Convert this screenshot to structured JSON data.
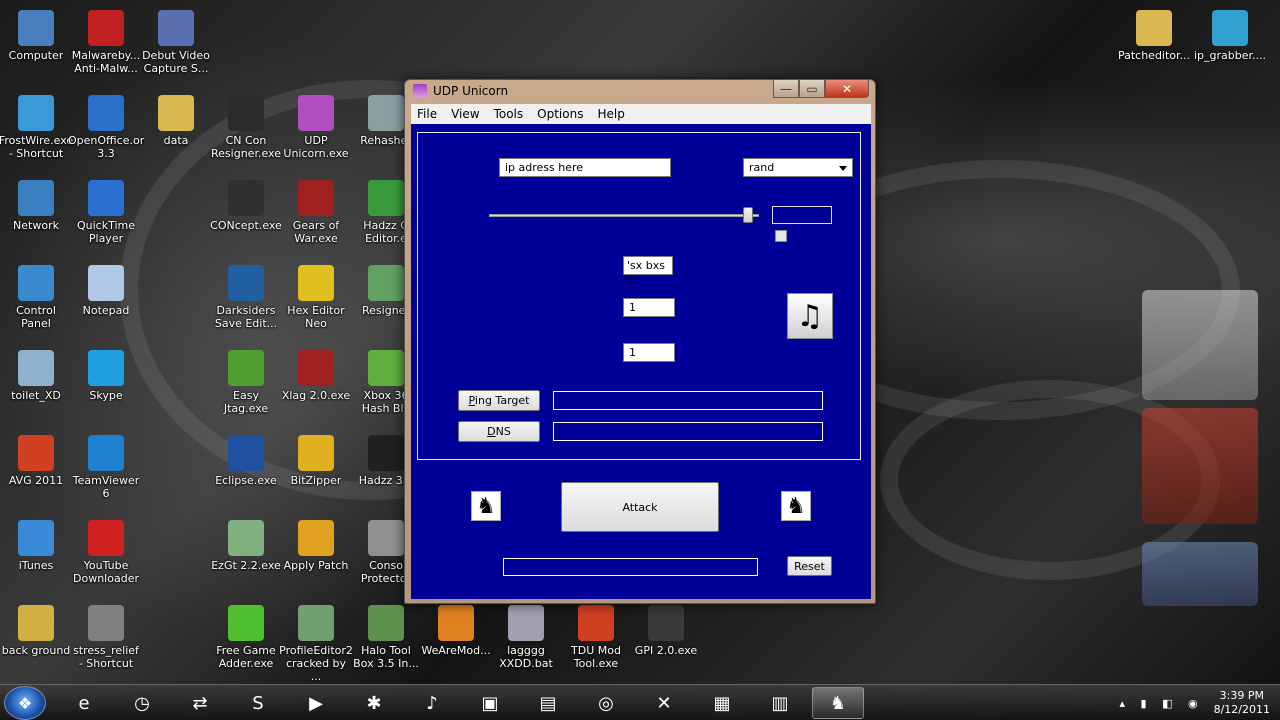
{
  "desktop_icons": [
    {
      "label": "Computer",
      "icon": "computer-icon",
      "color": "#4a7fbf"
    },
    {
      "label": "Malwareby... Anti-Malw...",
      "icon": "malwarebytes-icon",
      "color": "#c02020"
    },
    {
      "label": "Debut Video Capture S...",
      "icon": "floppy-icon",
      "color": "#5a6fb0"
    },
    {
      "label": "FrostWire.exe - Shortcut",
      "icon": "frostwire-icon",
      "color": "#3a9ad8"
    },
    {
      "label": "OpenOffice.org 3.3",
      "icon": "openoffice-icon",
      "color": "#2a70c8"
    },
    {
      "label": "data",
      "icon": "folder-icon",
      "color": "#d9b850"
    },
    {
      "label": "CN Con Resigner.exe",
      "icon": "cn-con-icon",
      "color": "#2a2a2a"
    },
    {
      "label": "UDP Unicorn.exe",
      "icon": "unicorn-icon",
      "color": "#b050c0"
    },
    {
      "label": "Rehasher",
      "icon": "rehasher-icon",
      "color": "#8aa0a0"
    },
    {
      "label": "Network",
      "icon": "network-icon",
      "color": "#3a7fbf"
    },
    {
      "label": "QuickTime Player",
      "icon": "quicktime-icon",
      "color": "#2a70d0"
    },
    {
      "label": "CONcept.exe",
      "icon": "concept-icon",
      "color": "#303030"
    },
    {
      "label": "Gears of War.exe",
      "icon": "gears-icon",
      "color": "#a02020"
    },
    {
      "label": "Hadzz G Editor.e",
      "icon": "hadzz-icon",
      "color": "#3a9a3a"
    },
    {
      "label": "Control Panel",
      "icon": "control-panel-icon",
      "color": "#3a8ad0"
    },
    {
      "label": "Notepad",
      "icon": "notepad-icon",
      "color": "#b0c8e8"
    },
    {
      "label": "Darksiders Save Edit...",
      "icon": "darksiders-icon",
      "color": "#2060a0"
    },
    {
      "label": "Hex Editor Neo",
      "icon": "hex-editor-icon",
      "color": "#e0c020"
    },
    {
      "label": "Resigner",
      "icon": "resigner-icon",
      "color": "#60a060"
    },
    {
      "label": "toilet_XD",
      "icon": "recycle-bin-icon",
      "color": "#90b0d0"
    },
    {
      "label": "Skype",
      "icon": "skype-icon",
      "color": "#20a0e0"
    },
    {
      "label": "Easy Jtag.exe",
      "icon": "xbox-icon",
      "color": "#50a030"
    },
    {
      "label": "Xlag 2.0.exe",
      "icon": "xlag-icon",
      "color": "#a02020"
    },
    {
      "label": "Xbox 36 Hash Blo",
      "icon": "xbox-hash-icon",
      "color": "#60b040"
    },
    {
      "label": "AVG 2011",
      "icon": "windows-logo-icon",
      "color": "#d04020"
    },
    {
      "label": "TeamViewer 6",
      "icon": "teamviewer-icon",
      "color": "#2080d0"
    },
    {
      "label": "Eclipse.exe",
      "icon": "eclipse-icon",
      "color": "#2050a0"
    },
    {
      "label": "BitZipper",
      "icon": "bitzipper-icon",
      "color": "#e0b020"
    },
    {
      "label": "Hadzz 3.0",
      "icon": "hadzz-h-icon",
      "color": "#202020"
    },
    {
      "label": "iTunes",
      "icon": "itunes-icon",
      "color": "#3a8ad8"
    },
    {
      "label": "YouTube Downloader",
      "icon": "youtube-downloader-icon",
      "color": "#d02020"
    },
    {
      "label": "EzGt 2.2.exe",
      "icon": "xbox-icon",
      "color": "#80b080"
    },
    {
      "label": "Apply Patch",
      "icon": "apply-patch-icon",
      "color": "#e0a020"
    },
    {
      "label": "Conso Protector",
      "icon": "protector-icon",
      "color": "#909090"
    },
    {
      "label": "back ground",
      "icon": "background-icon",
      "color": "#d0b040"
    },
    {
      "label": "stress_relief - Shortcut",
      "icon": "stress-relief-icon",
      "color": "#808080"
    },
    {
      "label": "Free Game Adder.exe",
      "icon": "plus-icon",
      "color": "#50c030"
    },
    {
      "label": "ProfileEditor2 cracked by ...",
      "icon": "xbox-icon",
      "color": "#70a070"
    },
    {
      "label": "Halo Tool Box 3.5 In...",
      "icon": "halo-icon",
      "color": "#609050"
    },
    {
      "label": "WeAreMod...",
      "icon": "firefox-icon",
      "color": "#e08020"
    },
    {
      "label": "lagggg XXDD.bat",
      "icon": "batch-icon",
      "color": "#a0a0b0"
    },
    {
      "label": "TDU Mod Tool.exe",
      "icon": "tdu-icon",
      "color": "#d04020"
    },
    {
      "label": "GPI 2.0.exe",
      "icon": "blank-exe-icon",
      "color": "#3a3a3a"
    },
    {
      "label": "Patcheditor...",
      "icon": "folder-icon",
      "color": "#d9b850"
    },
    {
      "label": "ip_grabber....",
      "icon": "globe-icon",
      "color": "#30a0d0"
    }
  ],
  "window": {
    "title": "UDP Unicorn",
    "close_glyph": "✕",
    "menu": [
      "File",
      "View",
      "Tools",
      "Options",
      "Help"
    ],
    "ip_input_value": "ip adress here",
    "port_select_value": "rand",
    "packet_select_value": "'sx bxs v",
    "threads_value": "1",
    "sockets_value": "1",
    "ping_button_label": "Ping Target",
    "dns_button_label": "DNS",
    "attack_button_label": "Attack",
    "reset_button_label": "Reset",
    "slider_level": 0.97,
    "accent_color": "#000099"
  },
  "taskbar": {
    "items": [
      "start-orb-icon",
      "internet-explorer-icon",
      "clock-app-icon",
      "teamviewer-icon",
      "skype-icon",
      "media-player-icon",
      "frostwire-icon",
      "itunes-icon",
      "debut-icon",
      "explorer-folder-icon",
      "chrome-icon",
      "xbox-icon",
      "debut-floppy-icon",
      "document-icon",
      "unicorn-icon"
    ],
    "active_item": "unicorn-icon",
    "time": "3:39 PM",
    "date": "8/12/2011"
  }
}
